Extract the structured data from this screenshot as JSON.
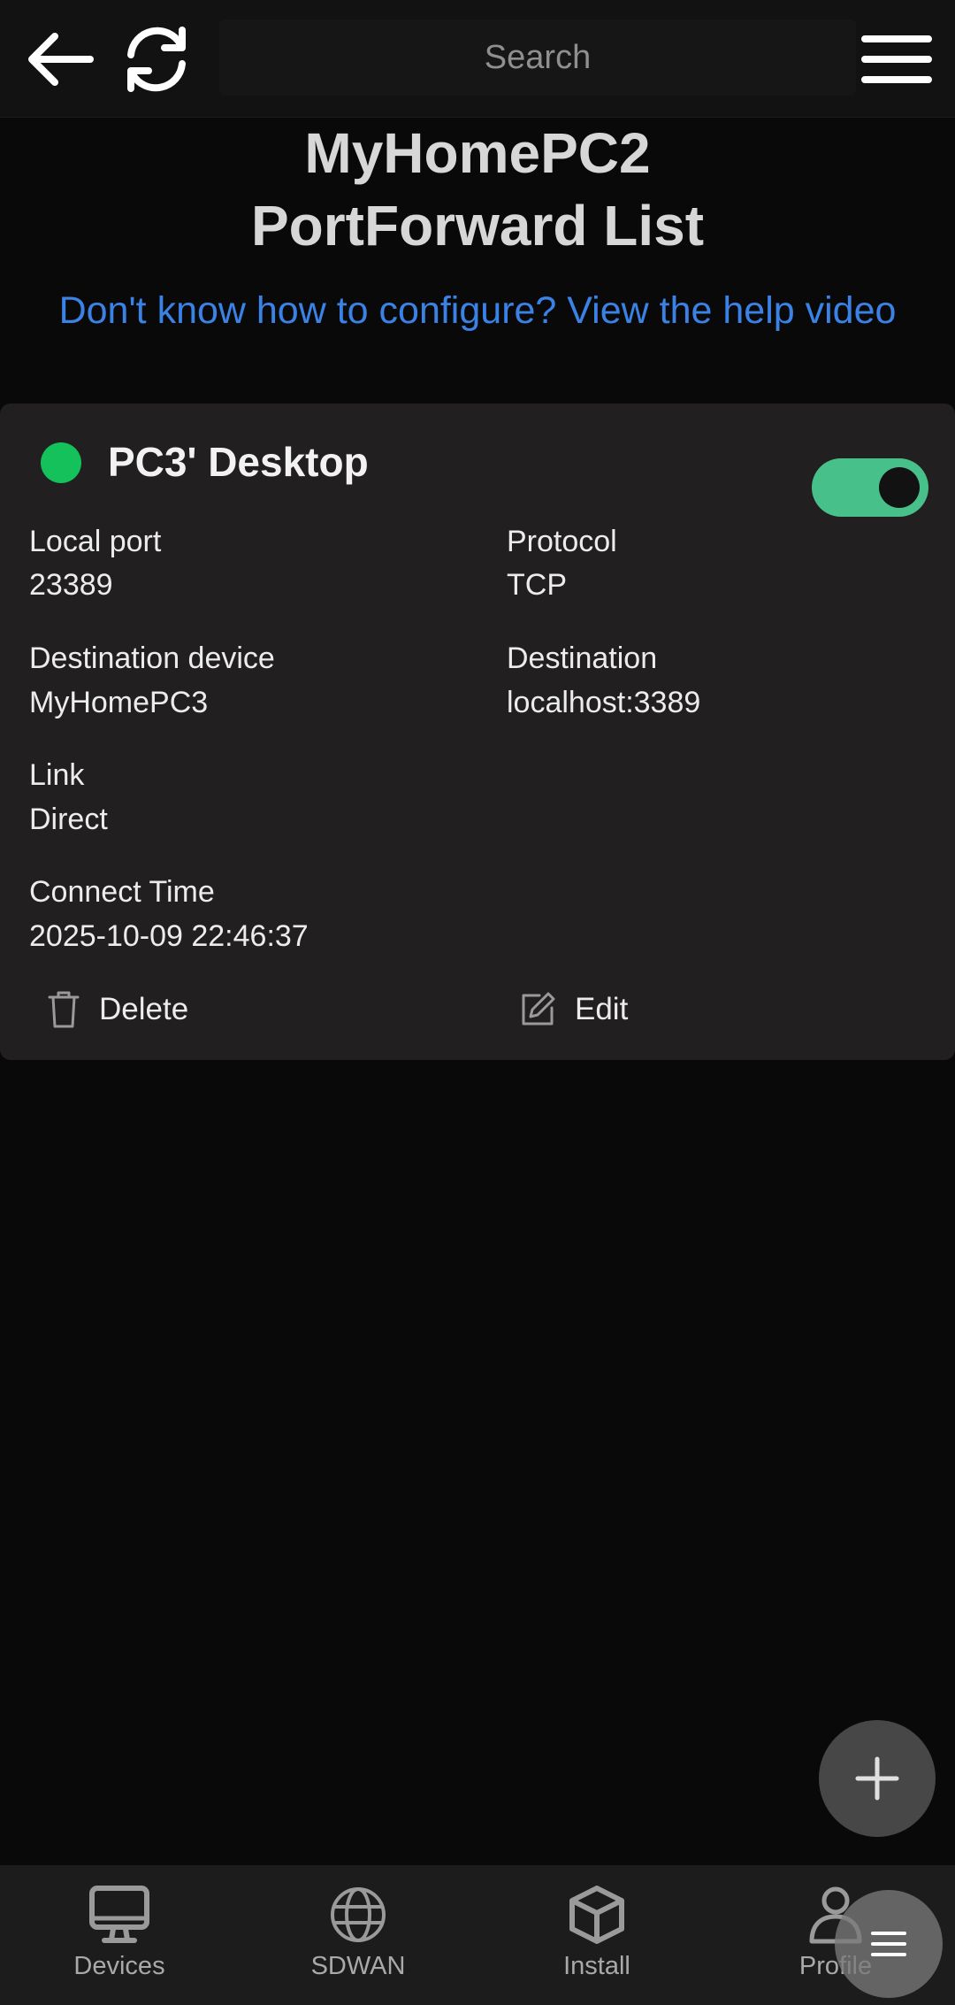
{
  "topbar": {
    "search_placeholder": "Search",
    "icons": [
      "arrow-left-icon",
      "refresh-icon",
      "hamburger-menu-icon"
    ]
  },
  "header": {
    "title_line1": "MyHomePC2",
    "title_line2": "PortForward List",
    "help_link": "Don't know how to configure? View the help video"
  },
  "card": {
    "name": "PC3' Desktop",
    "status_color": "#15c15b",
    "enabled": true,
    "toggle_color": "#48c08a",
    "fields": {
      "local_port_label": "Local port",
      "local_port_value": "23389",
      "protocol_label": "Protocol",
      "protocol_value": "TCP",
      "destination_device_label": "Destination device",
      "destination_device_value": "MyHomePC3",
      "destination_label": "Destination",
      "destination_value": "localhost:3389",
      "link_label": "Link",
      "link_value": "Direct",
      "connect_time_label": "Connect Time",
      "connect_time_value": "2025-10-09 22:46:37"
    },
    "actions": {
      "delete_label": "Delete",
      "edit_label": "Edit"
    }
  },
  "fab": {
    "icon": "plus-icon"
  },
  "bottom_nav": {
    "items": [
      {
        "label": "Devices",
        "icon": "monitor-icon"
      },
      {
        "label": "SDWAN",
        "icon": "globe-icon"
      },
      {
        "label": "Install",
        "icon": "cube-icon"
      },
      {
        "label": "Profile",
        "icon": "person-icon"
      }
    ]
  },
  "floating_menu": {
    "icon": "lines-menu-icon"
  },
  "colors": {
    "background": "#090909",
    "card": "#211f1f",
    "link": "#3b82e6"
  }
}
